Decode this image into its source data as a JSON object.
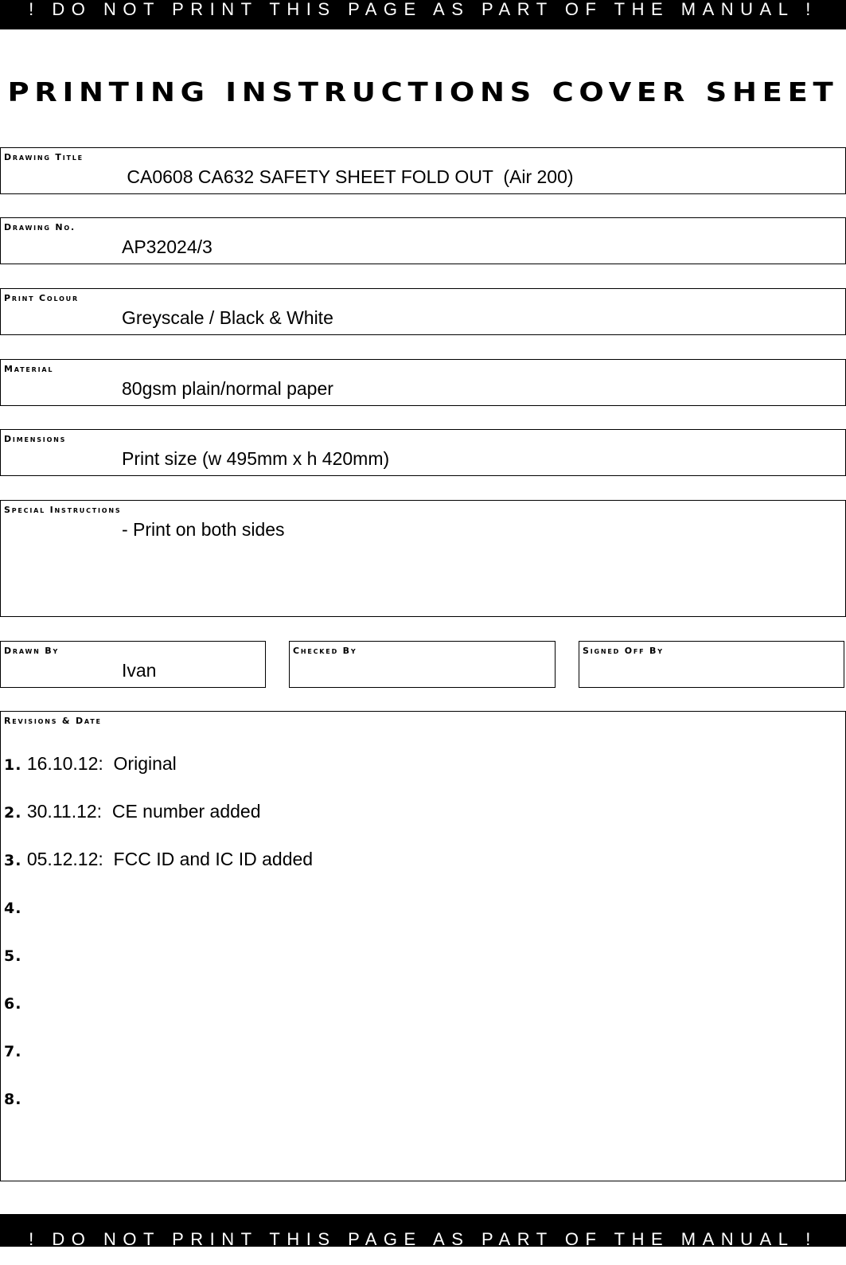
{
  "banner": {
    "text": "! DO NOT PRINT THIS PAGE AS PART OF THE MANUAL !"
  },
  "page_title": "PRINTING INSTRUCTIONS COVER SHEET",
  "fields": {
    "drawing_title": {
      "label": "Drawing Title",
      "value": " CA0608 CA632 SAFETY SHEET FOLD OUT  (Air 200)"
    },
    "drawing_no": {
      "label": "Drawing No.",
      "value": "AP32024/3"
    },
    "print_colour": {
      "label": "Print Colour",
      "value": "Greyscale / Black & White"
    },
    "material": {
      "label": "Material",
      "value": "80gsm plain/normal paper"
    },
    "dimensions": {
      "label": "Dimensions",
      "value": "Print size (w 495mm x h 420mm)"
    },
    "special_instructions": {
      "label": "Special Instructions",
      "value": "- Print on both sides"
    }
  },
  "signoff": {
    "drawn_by": {
      "label": "Drawn By",
      "value": "Ivan"
    },
    "checked_by": {
      "label": "Checked By",
      "value": ""
    },
    "signed_off_by": {
      "label": "Signed Off By",
      "value": ""
    }
  },
  "revisions": {
    "label": "Revisions & Date",
    "items": [
      {
        "num": "1.",
        "text": " 16.10.12:  Original"
      },
      {
        "num": "2.",
        "text": " 30.11.12:  CE number added"
      },
      {
        "num": "3.",
        "text": " 05.12.12:  FCC ID and IC ID added"
      },
      {
        "num": "4.",
        "text": ""
      },
      {
        "num": "5.",
        "text": ""
      },
      {
        "num": "6.",
        "text": ""
      },
      {
        "num": "7.",
        "text": ""
      },
      {
        "num": "8.",
        "text": ""
      }
    ]
  }
}
